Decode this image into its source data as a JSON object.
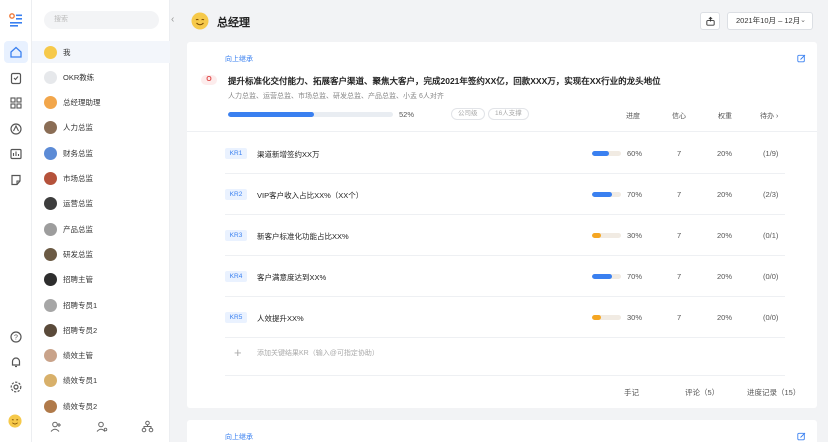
{
  "header": {
    "title": "总经理",
    "date_range": "2021年10月 – 12月"
  },
  "panel": {
    "search_placeholder": "搜索",
    "members": [
      {
        "name": "我",
        "avatar_color": "#f6c94a"
      },
      {
        "name": "OKR教练",
        "avatar_color": "#e6e8eb"
      },
      {
        "name": "总经理助理",
        "avatar_color": "#f2a64b"
      },
      {
        "name": "人力总监",
        "avatar_color": "#8a6d55"
      },
      {
        "name": "财务总监",
        "avatar_color": "#5c8bd6"
      },
      {
        "name": "市场总监",
        "avatar_color": "#b5523b"
      },
      {
        "name": "运营总监",
        "avatar_color": "#3d3d3d"
      },
      {
        "name": "产品总监",
        "avatar_color": "#9d9d9d"
      },
      {
        "name": "研发总监",
        "avatar_color": "#6b5a44"
      },
      {
        "name": "招聘主管",
        "avatar_color": "#2e2e2e"
      },
      {
        "name": "招聘专员1",
        "avatar_color": "#a6a6a6"
      },
      {
        "name": "招聘专员2",
        "avatar_color": "#5a4a3a"
      },
      {
        "name": "绩效主管",
        "avatar_color": "#c9a38a"
      },
      {
        "name": "绩效专员1",
        "avatar_color": "#d8b06a"
      },
      {
        "name": "绩效专员2",
        "avatar_color": "#b07a4a"
      }
    ]
  },
  "objective": {
    "parent_link": "向上继承",
    "badge": "O",
    "title": "提升标准化交付能力、拓展客户渠道、聚焦大客户，完成2021年签约XX亿，回款XXX万，实现在XX行业的龙头地位",
    "meta": "人力总监、运营总监、市场总监、研发总监、产品总监、小孟  6人对齐",
    "progress": 0.52,
    "progress_label": "52%",
    "tag_public": "公司级",
    "tag_support": "16人支撑",
    "columns": {
      "progress": "进度",
      "confidence": "信心",
      "weight": "权重",
      "todo": "待办"
    }
  },
  "key_results": [
    {
      "id": "KR1",
      "title": "渠道新增签约XX万",
      "progress": 0.6,
      "progress_label": "60%",
      "confidence": "7",
      "weight": "20%",
      "todo": "(1/9)",
      "color": "#3a80f0"
    },
    {
      "id": "KR2",
      "title": "VIP客户收入占比XX%（XX个）",
      "progress": 0.7,
      "progress_label": "70%",
      "confidence": "7",
      "weight": "20%",
      "todo": "(2/3)",
      "color": "#3a80f0"
    },
    {
      "id": "KR3",
      "title": "新客户标准化功能占比XX%",
      "progress": 0.3,
      "progress_label": "30%",
      "confidence": "7",
      "weight": "20%",
      "todo": "(0/1)",
      "color": "#f5a623"
    },
    {
      "id": "KR4",
      "title": "客户满意度达到XX%",
      "progress": 0.7,
      "progress_label": "70%",
      "confidence": "7",
      "weight": "20%",
      "todo": "(0/0)",
      "color": "#3a80f0"
    },
    {
      "id": "KR5",
      "title": "人效提升XX%",
      "progress": 0.3,
      "progress_label": "30%",
      "confidence": "7",
      "weight": "20%",
      "todo": "(0/0)",
      "color": "#f5a623"
    }
  ],
  "add_kr_placeholder": "添加关键结果KR（输入@可指定协助）",
  "footer": {
    "notes": "手记",
    "comments": "评论（5）",
    "records": "进度记录（15）"
  },
  "next_card": {
    "parent_link": "向上继承"
  }
}
